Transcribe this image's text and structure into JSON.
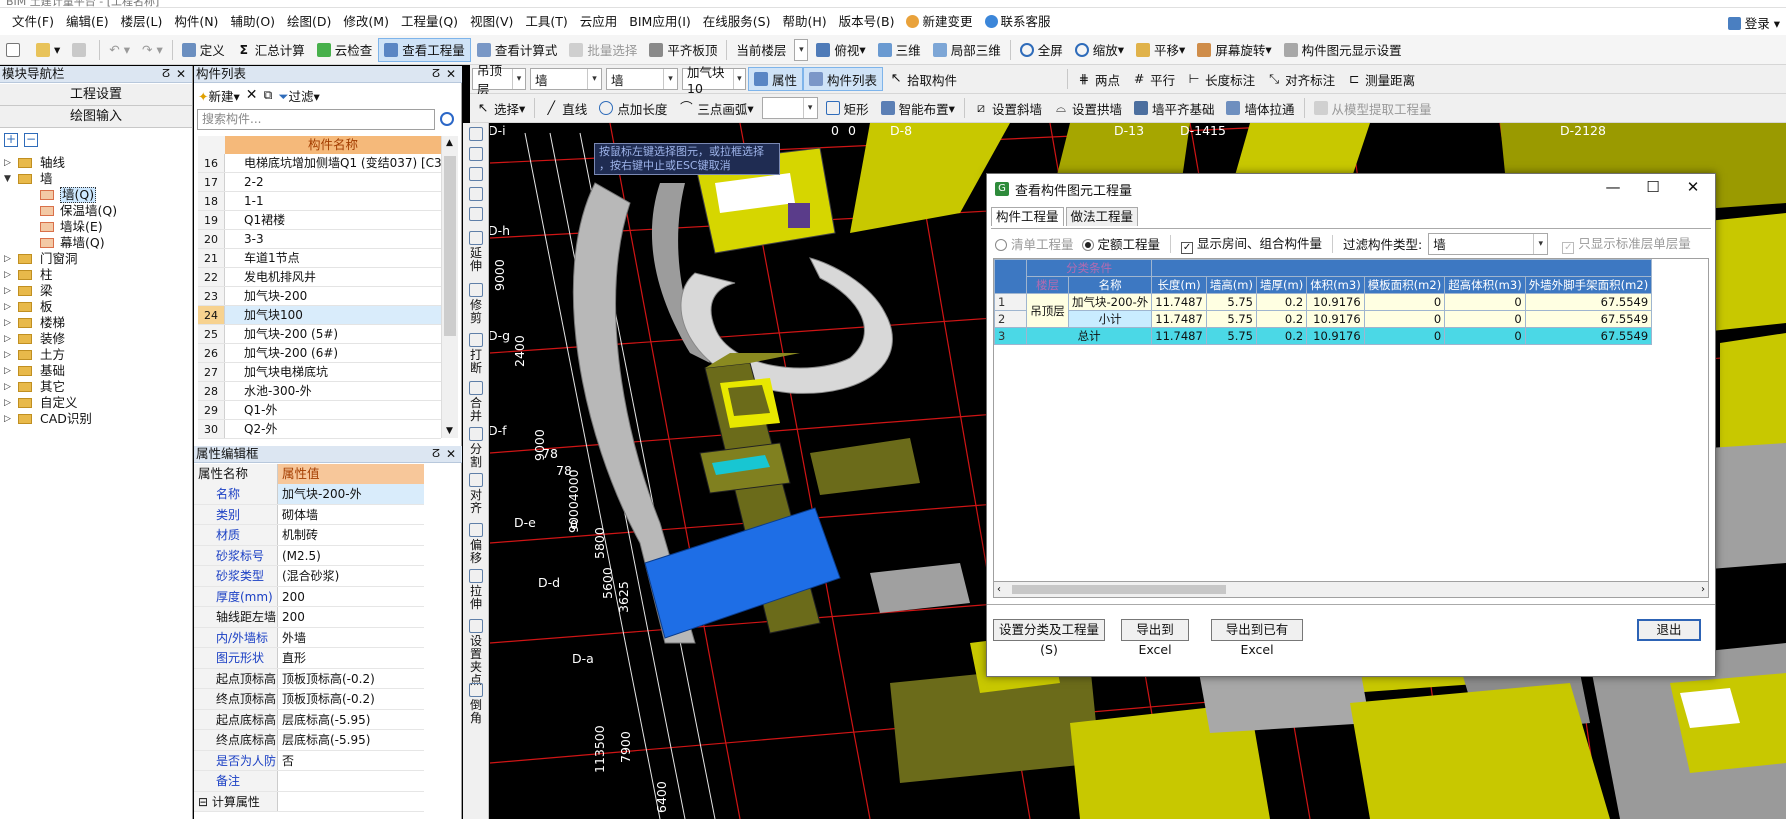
{
  "title_fragment": "BIM 土建计量平台 - [工程名称]",
  "menu": [
    "文件(F)",
    "编辑(E)",
    "楼层(L)",
    "构件(N)",
    "辅助(O)",
    "绘图(D)",
    "修改(M)",
    "工程量(Q)",
    "视图(V)",
    "工具(T)",
    "云应用",
    "BIM应用(I)",
    "在线服务(S)",
    "帮助(H)",
    "版本号(B)"
  ],
  "menu_right": {
    "new_change": "新建变更",
    "support": "联系客服",
    "login": "登录"
  },
  "toolbar1": {
    "define": "定义",
    "summary": "汇总计算",
    "cloud_check": "云检查",
    "view_quantity": "查看工程量",
    "view_formula": "查看计算式",
    "batch_select": "批量选择",
    "level_slab": "平齐板顶",
    "current_floor": "当前楼层",
    "top_view": "俯视",
    "three_d": "三维",
    "local_3d": "局部三维",
    "full_view": "全屏",
    "zoom": "缩放",
    "pan": "平移",
    "rotate": "屏幕旋转",
    "elem_display": "构件图元显示设置"
  },
  "toolbar2": {
    "floor": "吊顶层",
    "type": "墙",
    "type2": "墙",
    "comp": "加气块10",
    "attr": "属性",
    "comp_list": "构件列表",
    "pick": "拾取构件",
    "two_points": "两点",
    "parallel": "平行",
    "dim_len": "长度标注",
    "dim_align": "对齐标注",
    "measure": "测量距离"
  },
  "toolbar3": {
    "select": "选择",
    "line": "直线",
    "point_len": "点加长度",
    "arc": "三点画弧",
    "rect": "矩形",
    "smart": "智能布置",
    "slope": "设置斜墙",
    "arch": "设置拱墙",
    "flat_base": "墙平齐基础",
    "wall_pull": "墙体拉通",
    "extract": "从模型提取工程量"
  },
  "nav": {
    "title": "模块导航栏",
    "btn_settings": "工程设置",
    "btn_input": "绘图输入",
    "tree": [
      {
        "label": "轴线",
        "open": false
      },
      {
        "label": "墙",
        "open": true,
        "children": [
          "墙(Q)",
          "保温墙(Q)",
          "墙垛(E)",
          "幕墙(Q)"
        ]
      },
      {
        "label": "门窗洞",
        "open": false
      },
      {
        "label": "柱",
        "open": false
      },
      {
        "label": "梁",
        "open": false
      },
      {
        "label": "板",
        "open": false
      },
      {
        "label": "楼梯",
        "open": false
      },
      {
        "label": "装修",
        "open": false
      },
      {
        "label": "土方",
        "open": false
      },
      {
        "label": "基础",
        "open": false
      },
      {
        "label": "其它",
        "open": false
      },
      {
        "label": "自定义",
        "open": false
      },
      {
        "label": "CAD识别",
        "open": false
      }
    ]
  },
  "complist": {
    "title": "构件列表",
    "new": "新建",
    "filter": "过滤",
    "search_placeholder": "搜索构件...",
    "col": "构件名称",
    "rows": [
      {
        "n": "16",
        "name": "电梯底坑增加侧墙Q1 (变结037) [C3"
      },
      {
        "n": "17",
        "name": "2-2"
      },
      {
        "n": "18",
        "name": "1-1"
      },
      {
        "n": "19",
        "name": "Q1裙楼"
      },
      {
        "n": "20",
        "name": "3-3"
      },
      {
        "n": "21",
        "name": "车道1节点"
      },
      {
        "n": "22",
        "name": "发电机排风井"
      },
      {
        "n": "23",
        "name": "加气块-200"
      },
      {
        "n": "24",
        "name": "加气块100"
      },
      {
        "n": "25",
        "name": "加气块-200 (5#)"
      },
      {
        "n": "26",
        "name": "加气块-200 (6#)"
      },
      {
        "n": "27",
        "name": "加气块电梯底坑"
      },
      {
        "n": "28",
        "name": "水池-300-外"
      },
      {
        "n": "29",
        "name": "Q1-外"
      },
      {
        "n": "30",
        "name": "Q2-外"
      }
    ]
  },
  "props": {
    "title": "属性编辑框",
    "col_name": "属性名称",
    "col_value": "属性值",
    "rows": [
      {
        "k": "名称",
        "v": "加气块-200-外",
        "blue": true
      },
      {
        "k": "类别",
        "v": "砌体墙",
        "blue": true
      },
      {
        "k": "材质",
        "v": "机制砖",
        "blue": true
      },
      {
        "k": "砂浆标号",
        "v": "(M2.5)",
        "blue": true
      },
      {
        "k": "砂浆类型",
        "v": "(混合砂浆)",
        "blue": true
      },
      {
        "k": "厚度(mm)",
        "v": "200",
        "blue": true
      },
      {
        "k": "轴线距左墙",
        "v": "200",
        "blue": false
      },
      {
        "k": "内/外墙标",
        "v": "外墙",
        "blue": true
      },
      {
        "k": "图元形状",
        "v": "直形",
        "blue": true
      },
      {
        "k": "起点顶标高",
        "v": "顶板顶标高(-0.2)",
        "blue": false
      },
      {
        "k": "终点顶标高",
        "v": "顶板顶标高(-0.2)",
        "blue": false
      },
      {
        "k": "起点底标高",
        "v": "层底标高(-5.95)",
        "blue": false
      },
      {
        "k": "终点底标高",
        "v": "层底标高(-5.95)",
        "blue": false
      },
      {
        "k": "是否为人防",
        "v": "否",
        "blue": true
      },
      {
        "k": "备注",
        "v": "",
        "blue": true
      },
      {
        "k": "计算属性",
        "v": "",
        "blue": false,
        "section": true
      }
    ]
  },
  "side_tools": [
    "延伸",
    "修剪",
    "打断",
    "合并",
    "分割",
    "对齐",
    "偏移",
    "拉伸",
    "设置夹点",
    "倒角"
  ],
  "viewport": {
    "tooltip_line1": "按鼠标左键选择图元，或拉框选择",
    "tooltip_line2": "，按右键中止或ESC键取消",
    "axis_labels": [
      "D-i",
      "D-h",
      "D-g",
      "D-f",
      "D-e",
      "D-d",
      "D-a",
      "D-8",
      "D-13",
      "D-1415",
      "D-2128",
      "0",
      "0",
      "78",
      "78",
      "0"
    ],
    "dims": [
      "4000",
      "5000",
      "9000",
      "2400",
      "9000",
      "90004000",
      "5800",
      "5600",
      "3625",
      "113500",
      "7900",
      "6400"
    ]
  },
  "dialog": {
    "title": "查看构件图元工程量",
    "tab_elem": "构件工程量",
    "tab_method": "做法工程量",
    "radio_list": "清单工程量",
    "radio_quota": "定额工程量",
    "chk_room": "显示房间、组合构件量",
    "filter_label": "过滤构件类型:",
    "filter_value": "墙",
    "chk_std": "只显示标准层单层量",
    "cat_header": "分类条件",
    "headers": [
      "楼层",
      "名称",
      "长度(m)",
      "墙高(m)",
      "墙厚(m)",
      "体积(m3)",
      "模板面积(m2)",
      "超高体积(m3)",
      "外墙外脚手架面积(m2)"
    ],
    "rows": [
      {
        "n": "1",
        "floor": "吊顶层",
        "name": "加气块-200-外",
        "len": "11.7487",
        "h": "5.75",
        "t": "0.2",
        "vol": "10.9176",
        "form": "0",
        "over": "0",
        "scaf": "67.5549"
      },
      {
        "n": "2",
        "floor": "",
        "name": "小计",
        "len": "11.7487",
        "h": "5.75",
        "t": "0.2",
        "vol": "10.9176",
        "form": "0",
        "over": "0",
        "scaf": "67.5549"
      },
      {
        "n": "3",
        "floor": "",
        "name": "总计",
        "len": "11.7487",
        "h": "5.75",
        "t": "0.2",
        "vol": "10.9176",
        "form": "0",
        "over": "0",
        "scaf": "67.5549"
      }
    ],
    "btn_set": "设置分类及工程量(S)",
    "btn_export": "导出到Excel",
    "btn_export_existing": "导出到已有Excel",
    "btn_exit": "退出"
  },
  "colors": {
    "accent": "#3d78c2",
    "total_row": "#4bd8e6",
    "wall_yellow": "#c8c800",
    "slab_blue": "#1e6ee6",
    "arrow_red": "#e8261c"
  }
}
